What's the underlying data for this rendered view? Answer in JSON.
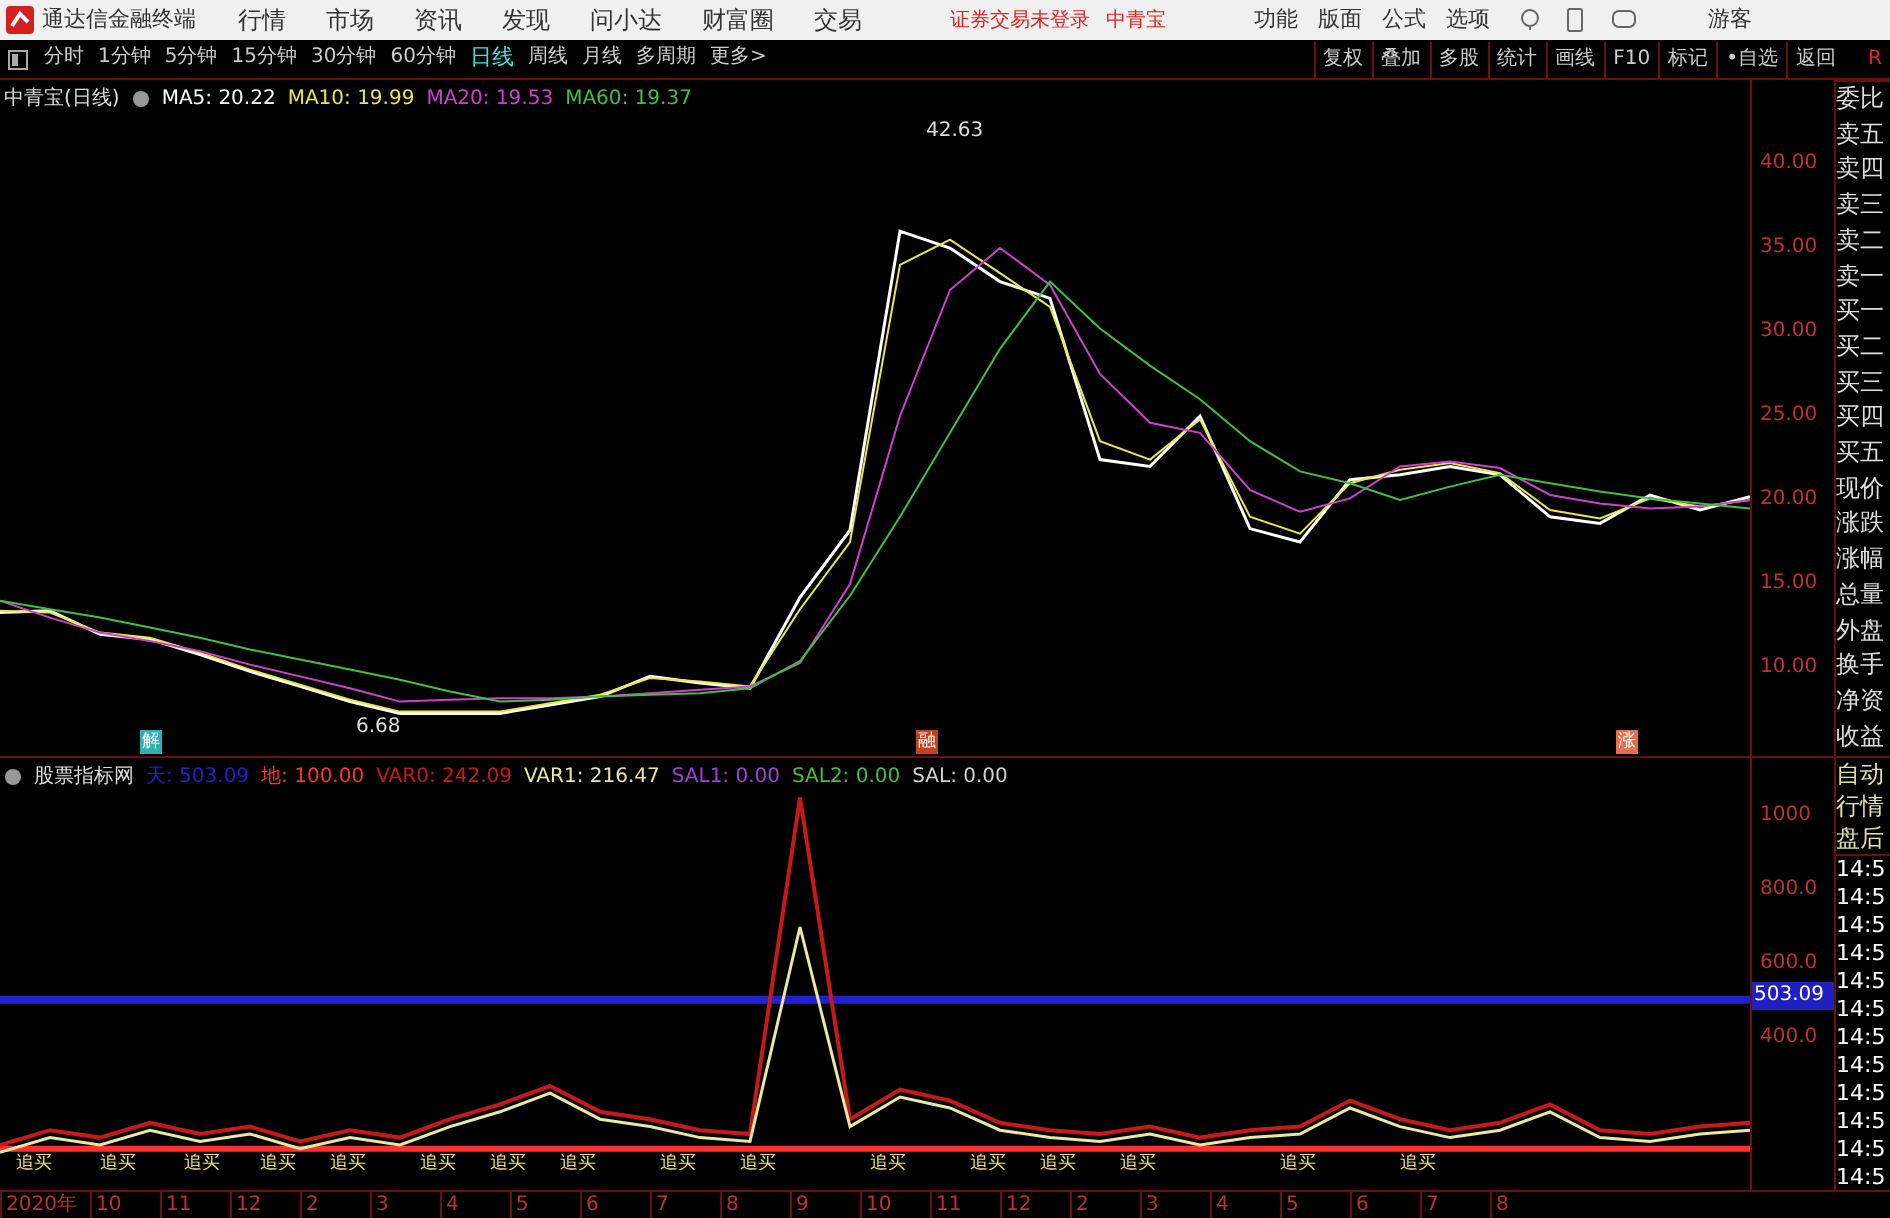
{
  "app": {
    "title": "通达信金融终端",
    "menu": [
      "行情",
      "市场",
      "资讯",
      "发现",
      "问小达",
      "财富圈",
      "交易"
    ],
    "login_notice": "证券交易未登录",
    "stock_link": "中青宝",
    "right_menu": [
      "功能",
      "版面",
      "公式",
      "选项"
    ],
    "user": "游客"
  },
  "periods": [
    {
      "label": "分时",
      "selected": false
    },
    {
      "label": "1分钟",
      "selected": false
    },
    {
      "label": "5分钟",
      "selected": false
    },
    {
      "label": "15分钟",
      "selected": false
    },
    {
      "label": "30分钟",
      "selected": false
    },
    {
      "label": "60分钟",
      "selected": false
    },
    {
      "label": "日线",
      "selected": true
    },
    {
      "label": "周线",
      "selected": false
    },
    {
      "label": "月线",
      "selected": false
    },
    {
      "label": "多周期",
      "selected": false
    },
    {
      "label": "更多>",
      "selected": false
    }
  ],
  "tools": [
    "复权",
    "叠加",
    "多股",
    "统计",
    "画线",
    "F10",
    "标记",
    "•自选",
    "返回"
  ],
  "tools_end": "R",
  "price_chart": {
    "title": "中青宝(日线)",
    "high_label": "42.63",
    "low_label": "6.68",
    "markers": [
      "解",
      "融",
      "涨"
    ],
    "chart_data": {
      "type": "line",
      "ylim": [
        4.76,
        45
      ],
      "yticks": [
        {
          "value": 40,
          "label": "40.00"
        },
        {
          "value": 35,
          "label": "35.00"
        },
        {
          "value": 30,
          "label": "30.00"
        },
        {
          "value": 25,
          "label": "25.00"
        },
        {
          "value": 20,
          "label": "20.00"
        },
        {
          "value": 15,
          "label": "15.00"
        },
        {
          "value": 10,
          "label": "10.00"
        }
      ],
      "series": [
        {
          "name": "MA5: 20.22",
          "color": "#ffffff",
          "values": [
            13.3,
            13.4,
            12.0,
            11.7,
            10.8,
            9.8,
            8.9,
            8.0,
            7.3,
            7.3,
            7.3,
            7.8,
            8.3,
            9.5,
            9.1,
            8.8,
            14.2,
            18.2,
            36.0,
            35.0,
            33.0,
            32.0,
            22.4,
            22.0,
            25.0,
            18.3,
            17.5,
            21.2,
            21.5,
            22.0,
            21.5,
            19.0,
            18.6,
            20.3,
            19.4,
            20.2
          ]
        },
        {
          "name": "MA10: 19.99",
          "color": "#e8e84a",
          "values": [
            13.4,
            13.3,
            12.1,
            11.8,
            10.9,
            9.9,
            9.0,
            8.1,
            7.4,
            7.4,
            7.4,
            7.9,
            8.4,
            9.4,
            9.2,
            8.9,
            13.5,
            17.5,
            34.0,
            35.5,
            33.5,
            31.5,
            23.5,
            22.4,
            24.8,
            19.0,
            18.0,
            21.0,
            21.8,
            22.2,
            21.6,
            19.4,
            18.9,
            20.1,
            19.6,
            20.0
          ]
        },
        {
          "name": "MA20: 19.53",
          "color": "#d040d0",
          "values": [
            14,
            13,
            12.1,
            11.6,
            11,
            10.2,
            9.5,
            8.8,
            8,
            8.1,
            8.2,
            8.2,
            8.3,
            8.5,
            8.7,
            8.9,
            10.3,
            15,
            25,
            32.5,
            35,
            32.8,
            27.5,
            24.6,
            24,
            20.6,
            19.3,
            20.1,
            22,
            22.3,
            21.9,
            20.3,
            19.8,
            19.5,
            19.6,
            20
          ]
        },
        {
          "name": "MA60: 19.37",
          "color": "#40c040",
          "values": [
            14,
            13.5,
            13,
            12.4,
            11.8,
            11.1,
            10.5,
            9.9,
            9.3,
            8.6,
            8,
            8.1,
            8.3,
            8.4,
            8.5,
            8.8,
            10.4,
            14.3,
            19,
            24,
            29,
            33,
            30.2,
            28,
            26,
            23.5,
            21.7,
            21,
            20,
            20.8,
            21.5,
            21,
            20.5,
            20.1,
            19.8,
            19.5
          ]
        }
      ]
    }
  },
  "quote_panel": [
    "委比",
    "卖五",
    "卖四",
    "卖三",
    "卖二",
    "卖一",
    "买一",
    "买二",
    "买三",
    "买四",
    "买五",
    "现价",
    "涨跌",
    "涨幅",
    "总量",
    "外盘",
    "换手",
    "净资",
    "收益"
  ],
  "indicator": {
    "name": "股票指标网",
    "legend": [
      {
        "text": "SAL1: 0.00",
        "color": "#a040e0"
      },
      {
        "text": "SAL2: 0.00",
        "color": "#40c040"
      },
      {
        "text": "SAL: 0.00",
        "color": "#d0d0d0"
      }
    ],
    "current_value": "503.09",
    "signals": [
      "追买",
      "追买",
      "追买",
      "追买",
      "追买",
      "追买",
      "追买",
      "追买",
      "追买",
      "追买",
      "追买",
      "追买",
      "追买",
      "追买",
      "追买",
      "追买"
    ],
    "chart_data": {
      "type": "line",
      "ylim": [
        -17,
        1157
      ],
      "yticks": [
        {
          "value": 1000,
          "label": "1000"
        },
        {
          "value": 800,
          "label": "800.0"
        },
        {
          "value": 600,
          "label": "600.0"
        },
        {
          "value": 400,
          "label": "400.0"
        }
      ],
      "series": [
        {
          "name": "天: 503.09",
          "color": "#2020d0",
          "values": [
            503,
            503,
            503,
            503,
            503,
            503,
            503,
            503,
            503,
            503,
            503,
            503,
            503,
            503,
            503,
            503,
            503,
            503,
            503,
            503,
            503,
            503,
            503,
            503,
            503,
            503,
            503,
            503,
            503,
            503,
            503,
            503,
            503,
            503,
            503,
            503
          ]
        },
        {
          "name": "地: 100.00",
          "color": "#ff3030",
          "values": [
            100,
            100,
            100,
            100,
            100,
            100,
            100,
            100,
            100,
            100,
            100,
            100,
            100,
            100,
            100,
            100,
            100,
            100,
            100,
            100,
            100,
            100,
            100,
            100,
            100,
            100,
            100,
            100,
            100,
            100,
            100,
            100,
            100,
            100,
            100,
            100
          ]
        },
        {
          "name": "VAR0: 242.09",
          "color": "#c81818",
          "values": [
            110,
            150,
            130,
            170,
            140,
            160,
            120,
            150,
            130,
            180,
            220,
            270,
            200,
            180,
            150,
            140,
            1050,
            180,
            260,
            230,
            170,
            150,
            140,
            160,
            130,
            150,
            160,
            230,
            180,
            150,
            170,
            220,
            150,
            140,
            160,
            170
          ]
        },
        {
          "name": "VAR1: 216.47",
          "color": "#e8e8a0",
          "values": [
            90,
            130,
            110,
            150,
            120,
            140,
            100,
            130,
            110,
            160,
            200,
            250,
            180,
            160,
            130,
            120,
            700,
            160,
            240,
            210,
            150,
            130,
            120,
            140,
            110,
            130,
            140,
            210,
            160,
            130,
            150,
            200,
            130,
            120,
            140,
            150
          ]
        }
      ]
    }
  },
  "side_tabs": [
    "自动",
    "行情",
    "盘后"
  ],
  "ticks_times": [
    "14:5",
    "14:5",
    "14:5",
    "14:5",
    "14:5",
    "14:5",
    "14:5",
    "14:5",
    "14:5",
    "14:5",
    "14:5",
    "14:5"
  ],
  "x_axis": [
    "2020年",
    "10",
    "11",
    "12",
    "2",
    "3",
    "4",
    "5",
    "6",
    "7",
    "8",
    "9",
    "10",
    "11",
    "12",
    "2",
    "3",
    "4",
    "5",
    "6",
    "7",
    "8"
  ]
}
